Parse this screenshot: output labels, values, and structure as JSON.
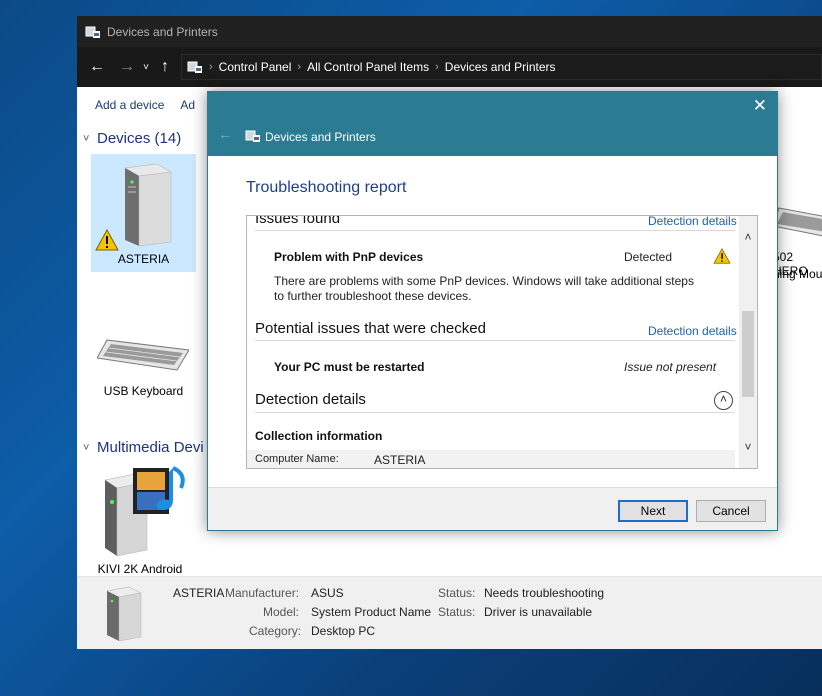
{
  "explorer": {
    "title": "Devices and Printers",
    "breadcrumbs": [
      "Control Panel",
      "All Control Panel Items",
      "Devices and Printers"
    ],
    "commands": [
      "Add a device",
      "Ad"
    ],
    "sections": {
      "devices": "Devices (14)",
      "multimedia": "Multimedia Devi"
    },
    "devices": [
      {
        "label": "ASTERIA",
        "icon": "desktop-pc-icon",
        "warning": true
      },
      {
        "label": "USB Keyboard",
        "icon": "keyboard-icon"
      },
      {
        "label": "502 HERO",
        "icon": "keyboard-icon"
      },
      {
        "label": "ning Mou",
        "icon": "mouse-icon"
      }
    ],
    "multimedia_devices": [
      {
        "label": "KIVI 2K Android",
        "icon": "media-device-icon"
      }
    ],
    "details": {
      "name": "ASTERIA",
      "manufacturer_label": "Manufacturer:",
      "manufacturer": "ASUS",
      "model_label": "Model:",
      "model": "System Product Name",
      "category_label": "Category:",
      "category": "Desktop PC",
      "status_label_1": "Status:",
      "status_1": "Needs troubleshooting",
      "status_label_2": "Status:",
      "status_2": "Driver is unavailable"
    }
  },
  "dialog": {
    "close": "✕",
    "back": "←",
    "title": "Devices and Printers",
    "heading": "Troubleshooting report",
    "issues_found": "Issues found",
    "detection_details_link_1": "Detection details",
    "problem_title": "Problem with PnP devices",
    "problem_status": "Detected",
    "problem_desc_1": "There are problems with some PnP devices. Windows will take additional steps",
    "problem_desc_2": "to further troubleshoot these devices.",
    "potential_issues": "Potential issues that were checked",
    "detection_details_link_2": "Detection details",
    "restart_title": "Your PC must be restarted",
    "restart_status": "Issue not present",
    "detection_details": "Detection details",
    "collection_info": "Collection information",
    "computer_name_label": "Computer Name:",
    "computer_name": "ASTERIA",
    "next": "Next",
    "cancel": "Cancel"
  },
  "colors": {
    "accent": "#2b7b92",
    "link": "#1e61a8",
    "heading": "#1e3e8c",
    "warning": "#f5c400"
  }
}
